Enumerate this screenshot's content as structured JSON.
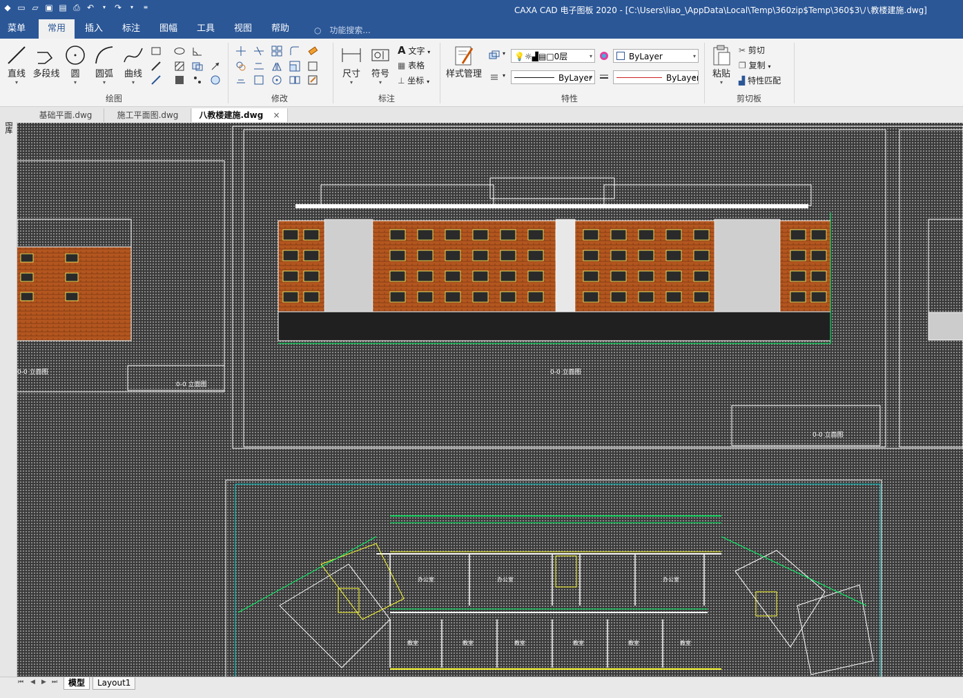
{
  "window": {
    "title": "CAXA CAD 电子图板 2020 - [C:\\Users\\liao_\\AppData\\Local\\Temp\\360zip$Temp\\360$3\\八教楼建施.dwg]"
  },
  "menu": {
    "items": [
      "菜单",
      "常用",
      "插入",
      "标注",
      "图幅",
      "工具",
      "视图",
      "帮助"
    ],
    "active_index": 1,
    "search_placeholder": "功能搜索..."
  },
  "ribbon": {
    "draw": {
      "label": "绘图",
      "line": "直线",
      "polyline": "多段线",
      "circle": "圆",
      "arc": "圆弧",
      "curve": "曲线"
    },
    "modify": {
      "label": "修改"
    },
    "annotate": {
      "label": "标注",
      "dimension": "尺寸",
      "symbol": "符号",
      "text": "文字",
      "table": "表格",
      "coordinate": "坐标"
    },
    "style": {
      "manager": "样式管理"
    },
    "properties": {
      "label": "特性",
      "layer": "0层",
      "color": "ByLayer",
      "linetype": "ByLayer",
      "lineweight": "ByLayer"
    },
    "clipboard": {
      "label": "剪切板",
      "paste": "粘贴",
      "cut": "剪切",
      "copy": "复制",
      "match": "特性匹配"
    }
  },
  "sidebar": {
    "label": "图库"
  },
  "doc_tabs": [
    "基础平面.dwg",
    "施工平面图.dwg",
    "八教楼建施.dwg"
  ],
  "drawing": {
    "left_elevation_label": "0-0 立面图",
    "left_section_label": "0-0 立面图",
    "main_elevation_label": "0-0 立面图",
    "title_block_label": "0-0 立面图",
    "room_labels": [
      "办公室",
      "办公室",
      "办公室",
      "教室",
      "教室",
      "教室",
      "教室",
      "教室",
      "教室"
    ]
  },
  "status": {
    "tabs": [
      "模型",
      "Layout1"
    ],
    "active_index": 0
  }
}
